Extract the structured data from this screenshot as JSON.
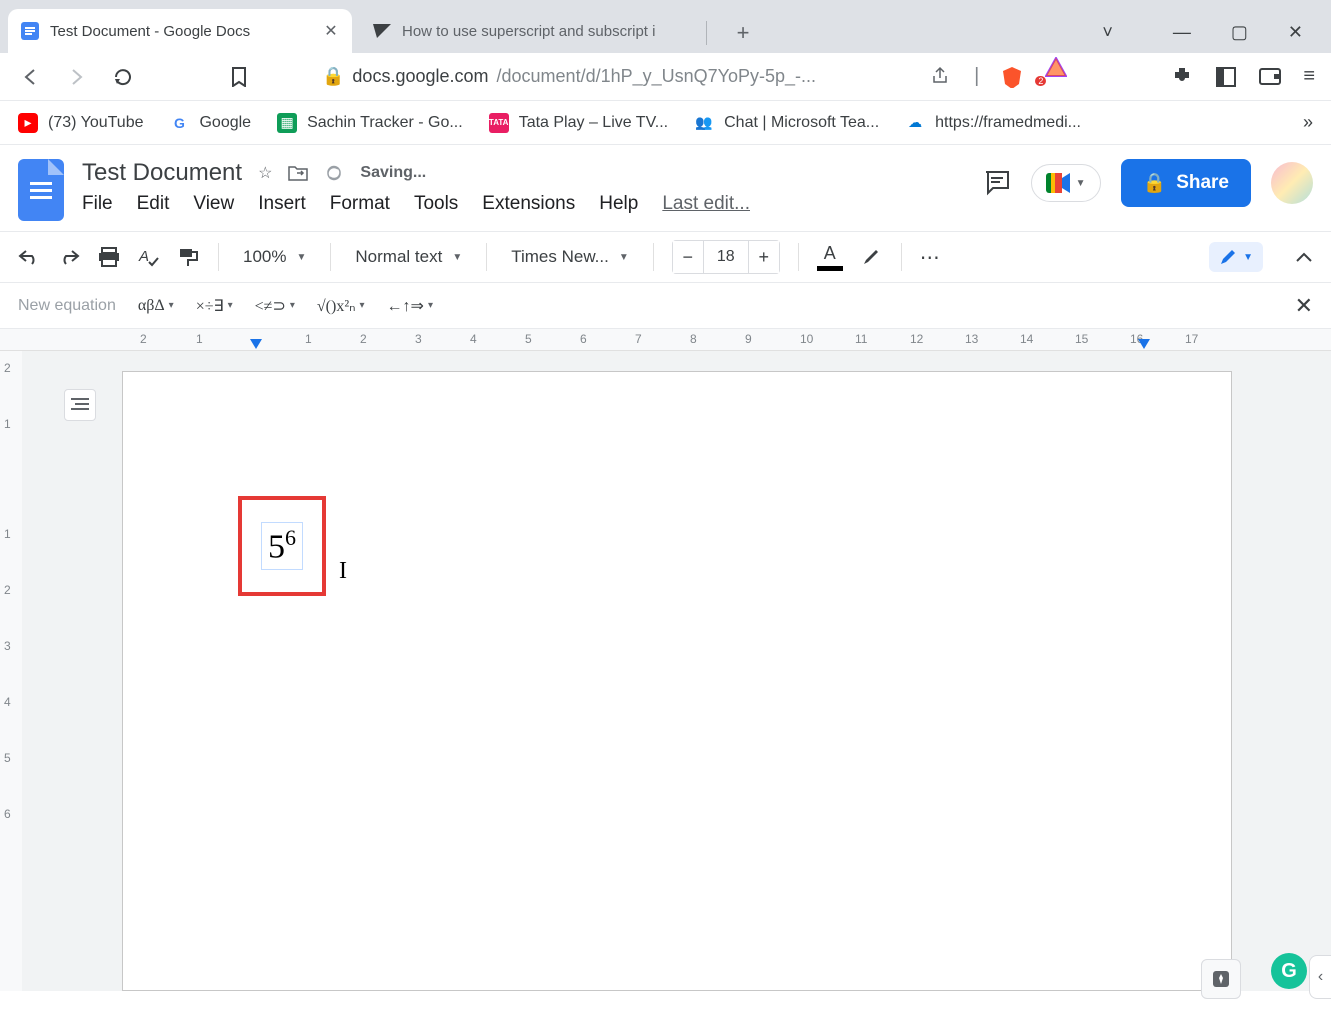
{
  "browser": {
    "tabs": [
      {
        "title": "Test Document - Google Docs",
        "active": true
      },
      {
        "title": "How to use superscript and subscript i",
        "active": false
      }
    ],
    "url_host": "docs.google.com",
    "url_path": "/document/d/1hP_y_UsnQ7YoPy-5p_-...",
    "shield_badge": "2"
  },
  "bookmarks": [
    {
      "label": "(73) YouTube",
      "color": "#ff0000",
      "tag": "▶"
    },
    {
      "label": "Google",
      "color": "#fff",
      "tag": "G"
    },
    {
      "label": "Sachin Tracker - Go...",
      "color": "#0f9d58",
      "tag": "▦"
    },
    {
      "label": "Tata Play – Live TV...",
      "color": "#e91e63",
      "tag": "TP"
    },
    {
      "label": "Chat | Microsoft Tea...",
      "color": "#6264a7",
      "tag": "⛬"
    },
    {
      "label": "https://framedmedi...",
      "color": "#0078d4",
      "tag": "☁"
    }
  ],
  "docs": {
    "title": "Test Document",
    "saving": "Saving...",
    "menu": [
      "File",
      "Edit",
      "View",
      "Insert",
      "Format",
      "Tools",
      "Extensions",
      "Help"
    ],
    "lastedit": "Last edit...",
    "share": "Share"
  },
  "toolbar": {
    "zoom": "100%",
    "style": "Normal text",
    "font": "Times New...",
    "font_size": "18"
  },
  "equation_toolbar": {
    "label": "New equation",
    "groups": [
      "αβΔ",
      "×÷∃",
      "<≠⊃",
      "√()x²ₙ",
      "←↑⇒"
    ]
  },
  "ruler_h": [
    "2",
    "1",
    "",
    "1",
    "2",
    "3",
    "4",
    "5",
    "6",
    "7",
    "8",
    "9",
    "10",
    "11",
    "12",
    "13",
    "14",
    "15",
    "16",
    "17"
  ],
  "ruler_v": [
    "2",
    "1",
    "",
    "1",
    "2",
    "3",
    "4",
    "5",
    "6"
  ],
  "document": {
    "equation_base": "5",
    "equation_sup": "6"
  }
}
